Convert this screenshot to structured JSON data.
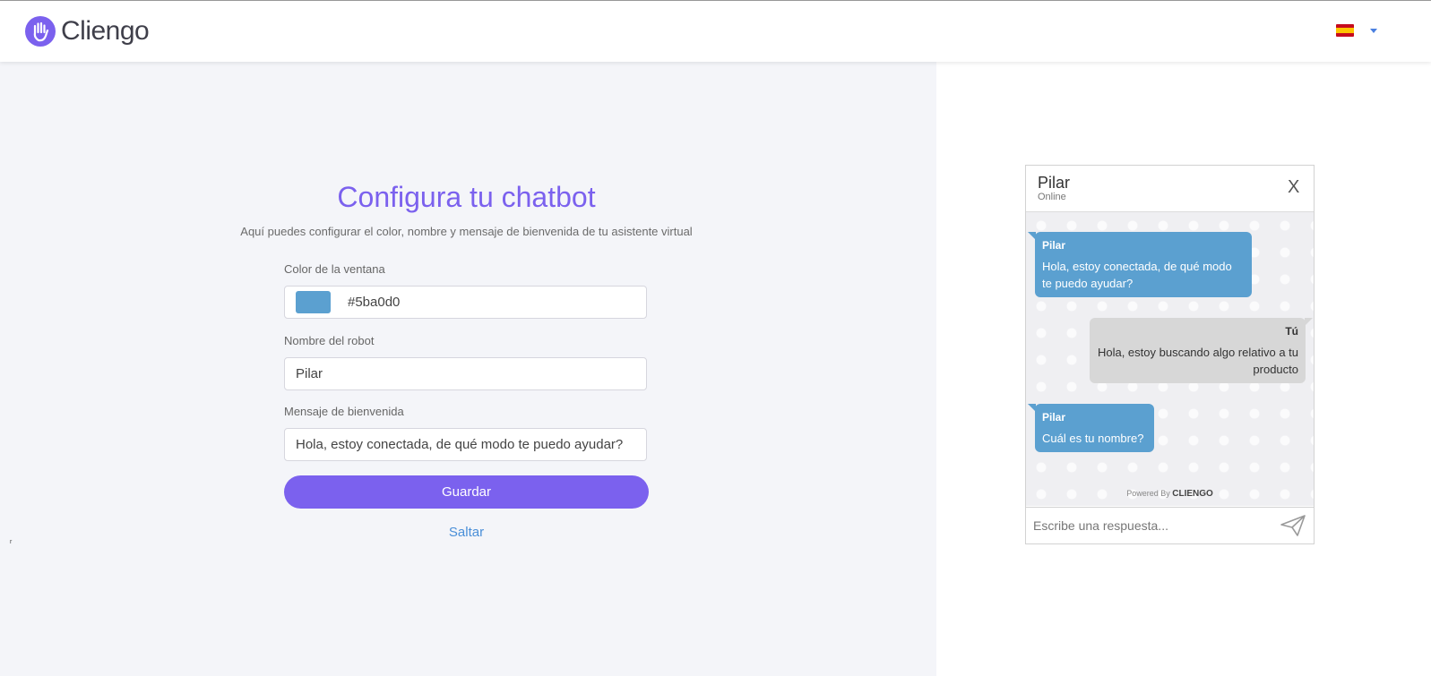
{
  "header": {
    "logo_text": "Cliengo",
    "language_flag": "es",
    "colors": {
      "brand": "#7b61ee"
    }
  },
  "form": {
    "title": "Configura tu chatbot",
    "subtitle": "Aquí puedes configurar el color, nombre y mensaje de bienvenida de tu asistente virtual",
    "color_label": "Color de la ventana",
    "color_value": "#5ba0d0",
    "name_label": "Nombre del robot",
    "name_value": "Pilar",
    "welcome_label": "Mensaje de bienvenida",
    "welcome_value": "Hola, estoy conectada, de qué modo te puedo ayudar?",
    "save_label": "Guardar",
    "skip_label": "Saltar",
    "stray_mark": "r"
  },
  "preview": {
    "bot_name": "Pilar",
    "status": "Online",
    "close_label": "X",
    "messages": [
      {
        "from": "Pilar",
        "text": "Hola, estoy conectada, de qué modo te puedo ayudar?",
        "side": "bot"
      },
      {
        "from": "Tú",
        "text": "Hola, estoy buscando algo relativo a tu producto",
        "side": "user"
      },
      {
        "from": "Pilar",
        "text": "Cuál es tu nombre?",
        "side": "bot"
      }
    ],
    "powered_by": "Powered By",
    "powered_brand": "CLIENGO",
    "input_placeholder": "Escribe una respuesta...",
    "colors": {
      "bubble_bot": "#5ba0d0",
      "bubble_user": "#d7d7d7"
    }
  }
}
